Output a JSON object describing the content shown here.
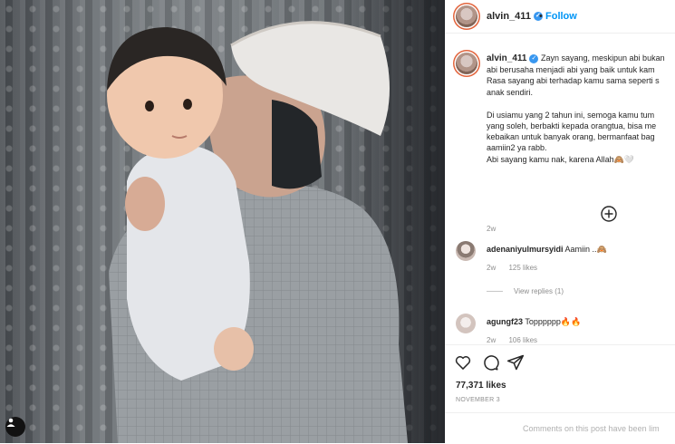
{
  "header": {
    "username": "alvin_411",
    "separator": "•",
    "follow_label": "Follow"
  },
  "caption": {
    "username": "alvin_411",
    "lines": [
      "Zayn sayang, meskipun abi bukan",
      "abi berusaha menjadi abi yang baik untuk kam",
      "Rasa sayang abi terhadap kamu sama seperti s",
      "anak sendiri.",
      "Di usiamu yang 2 tahun ini, semoga kamu tum",
      "yang soleh, berbakti kepada orangtua, bisa me",
      "kebaikan untuk banyak orang, bermanfaat bag",
      "aamiin2 ya rabb.",
      "Abi sayang kamu nak, karena Allah🙈🤍"
    ],
    "time": "2w"
  },
  "comments": [
    {
      "username": "adenaniyulmursyidi",
      "text": "Aamiin ..🙈",
      "time": "2w",
      "likes": "125 likes"
    },
    {
      "username": "agungf23",
      "text": "Topppppp🔥🔥",
      "time": "2w",
      "likes": "106 likes"
    }
  ],
  "view_replies": "View replies (1)",
  "post": {
    "likes": "77,371 likes",
    "date": "NOVEMBER 3"
  },
  "footer": {
    "text": "Comments on this post have been lim"
  },
  "icons": {
    "verified": "verified-badge-icon",
    "add": "plus-circle-icon",
    "like": "heart-icon",
    "comment": "comment-bubble-icon",
    "share": "paper-plane-icon",
    "user_tag": "user-tag-icon"
  },
  "colors": {
    "follow": "#0095f6",
    "verified": "#3897f0",
    "muted": "#8e8e8e",
    "text": "#262626"
  }
}
